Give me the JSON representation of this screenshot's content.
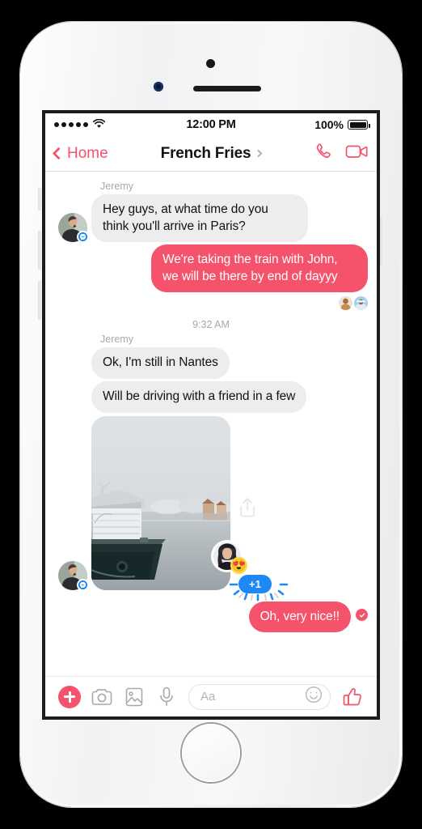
{
  "status_bar": {
    "signal_dots": 5,
    "wifi_icon": "wifi-icon",
    "time": "12:00 PM",
    "battery_percent": "100%"
  },
  "nav_bar": {
    "back_label": "Home",
    "title": "French Fries",
    "title_chevron_icon": "chevron-right-icon",
    "call_icon": "phone-icon",
    "video_icon": "video-camera-icon"
  },
  "thread": {
    "sender_name_1": "Jeremy",
    "message_1": "Hey guys, at what time do you think you'll arrive in Paris?",
    "message_2": "We're taking the train with John, we will be there by end of dayyy",
    "timestamp": "9:32 AM",
    "sender_name_2": "Jeremy",
    "message_3": "Ok, I'm still in Nantes",
    "message_4": "Will be driving with a friend in a few",
    "photo_alt": "Frozen river with moored houseboat",
    "share_icon": "share-upload-icon",
    "reaction_emoji": "😍",
    "reaction_count": "+1",
    "message_5": "Oh, very nice!!",
    "delivered_icon": "delivered-check-icon"
  },
  "composer": {
    "add_icon": "plus-circle-icon",
    "camera_icon": "camera-icon",
    "gallery_icon": "photo-gallery-icon",
    "mic_icon": "microphone-icon",
    "input_placeholder": "Aa",
    "emoji_icon": "smiley-icon",
    "thumb_icon": "thumbs-up-icon"
  },
  "colors": {
    "accent": "#f4536b",
    "incoming_bubble": "#ededed",
    "reaction_blue": "#1e88f7",
    "messenger_blue": "#0084ff"
  }
}
